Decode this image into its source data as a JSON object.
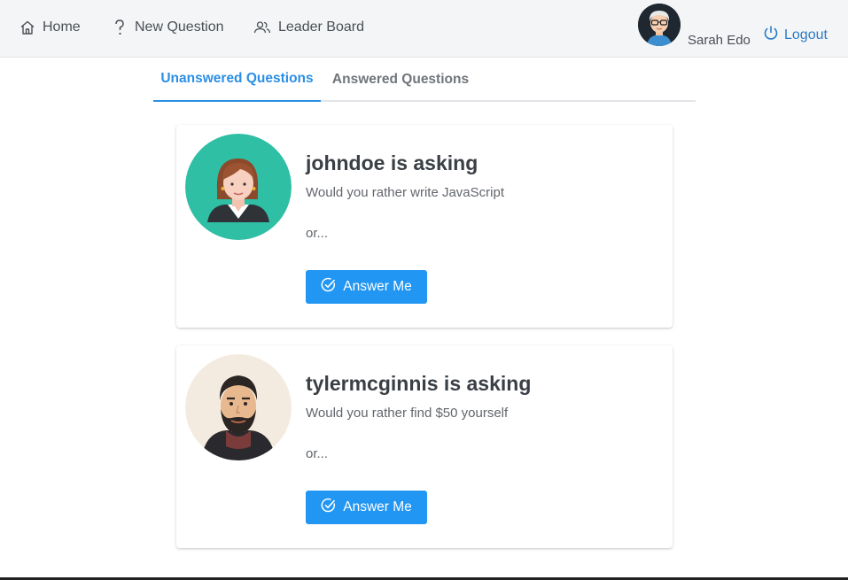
{
  "nav": {
    "home": "Home",
    "new_question": "New Question",
    "leader_board": "Leader Board",
    "user_name": "Sarah Edo",
    "logout": "Logout"
  },
  "tabs": {
    "unanswered": "Unanswered Questions",
    "answered": "Answered Questions"
  },
  "questions": [
    {
      "title": "johndoe is asking",
      "text": "Would you rather write JavaScript",
      "or": "or...",
      "button": "Answer Me",
      "avatar": "woman-avatar"
    },
    {
      "title": "tylermcginnis is asking",
      "text": "Would you rather find $50 yourself",
      "or": "or...",
      "button": "Answer Me",
      "avatar": "bearded-man-avatar"
    }
  ],
  "colors": {
    "accent": "#2196f3",
    "tab_active": "#2a8fe6",
    "logout": "#2a7cc7"
  }
}
